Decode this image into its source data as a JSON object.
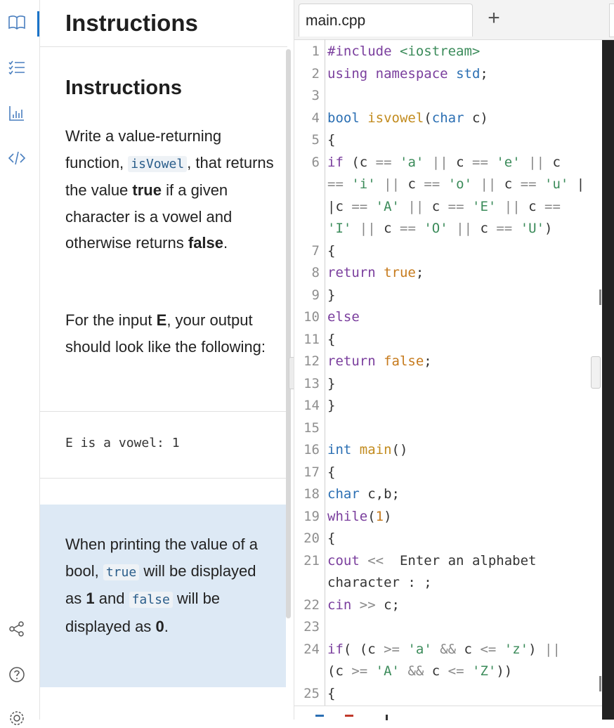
{
  "sidebar": {
    "icons": [
      "book-icon",
      "checklist-icon",
      "bar-chart-icon",
      "code-icon",
      "share-icon",
      "help-icon",
      "settings-icon"
    ]
  },
  "instructions": {
    "header_title": "Instructions",
    "content_title": "Instructions",
    "para1": {
      "t1": "Write a value-returning function,",
      "code": "isVowel",
      "t2": ", that returns the value",
      "b1": "true",
      "t3": "if a given character is a vowel and otherwise returns",
      "b2": "false",
      "t4": "."
    },
    "para2": {
      "t1": "For the input",
      "b1": "E",
      "t2": ", your output should look like the following:"
    },
    "sample_output": "E is a vowel: 1",
    "note": {
      "t1": "When printing the value of a bool,",
      "code1": "true",
      "t2": "will be displayed as",
      "b1": "1",
      "t3": "and",
      "code2": "false",
      "t4": "will be displayed as",
      "b2": "0",
      "t5": "."
    }
  },
  "editor": {
    "tab_label": "main.cpp",
    "add_tab": "+",
    "lines": [
      {
        "n": "1",
        "t": "#include <iostream>"
      },
      {
        "n": "2",
        "t": "using namespace std;"
      },
      {
        "n": "3",
        "t": ""
      },
      {
        "n": "4",
        "t": "bool isvowel(char c)"
      },
      {
        "n": "5",
        "t": "{"
      },
      {
        "n": "6",
        "t": "if (c == 'a' || c == 'e' || c"
      },
      {
        "n": "",
        "t": "== 'i' || c == 'o' || c == 'u' |"
      },
      {
        "n": "",
        "t": "|c == 'A' || c == 'E' || c =="
      },
      {
        "n": "",
        "t": "'I' || c == 'O' || c == 'U')"
      },
      {
        "n": "7",
        "t": "{"
      },
      {
        "n": "8",
        "t": "return true;"
      },
      {
        "n": "9",
        "t": "}"
      },
      {
        "n": "10",
        "t": "else"
      },
      {
        "n": "11",
        "t": "{"
      },
      {
        "n": "12",
        "t": "return false;"
      },
      {
        "n": "13",
        "t": "}"
      },
      {
        "n": "14",
        "t": "}"
      },
      {
        "n": "15",
        "t": ""
      },
      {
        "n": "16",
        "t": "int main()"
      },
      {
        "n": "17",
        "t": "{"
      },
      {
        "n": "18",
        "t": "char c,b;"
      },
      {
        "n": "19",
        "t": "while(1)"
      },
      {
        "n": "20",
        "t": "{"
      },
      {
        "n": "21",
        "t": "cout << \" Enter an alphabet"
      },
      {
        "n": "",
        "t": "character : \";"
      },
      {
        "n": "22",
        "t": "cin >> c;"
      },
      {
        "n": "23",
        "t": ""
      },
      {
        "n": "24",
        "t": "if( (c >= 'a' && c <= 'z') ||"
      },
      {
        "n": "",
        "t": "(c >= 'A' && c <= 'Z'))"
      },
      {
        "n": "25",
        "t": "{"
      }
    ]
  }
}
